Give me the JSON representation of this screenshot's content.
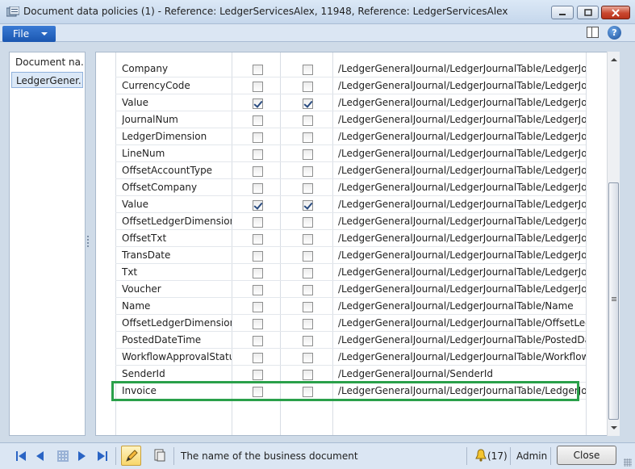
{
  "window": {
    "title": "Document data policies (1) - Reference: LedgerServicesAlex, 11948, Reference: LedgerServicesAlex"
  },
  "menu": {
    "file_label": "File"
  },
  "left_pane": {
    "items": [
      {
        "label": "Document na...",
        "selected": false
      },
      {
        "label": "LedgerGener...",
        "selected": true
      }
    ]
  },
  "grid": {
    "rows": [
      {
        "name": "Company",
        "c1": false,
        "c2": false,
        "path": "/LedgerGeneralJournal/LedgerJournalTable/LedgerJo..."
      },
      {
        "name": "CurrencyCode",
        "c1": false,
        "c2": false,
        "path": "/LedgerGeneralJournal/LedgerJournalTable/LedgerJo..."
      },
      {
        "name": "Value",
        "c1": true,
        "c2": true,
        "path": "/LedgerGeneralJournal/LedgerJournalTable/LedgerJo..."
      },
      {
        "name": "JournalNum",
        "c1": false,
        "c2": false,
        "path": "/LedgerGeneralJournal/LedgerJournalTable/LedgerJo..."
      },
      {
        "name": "LedgerDimension",
        "c1": false,
        "c2": false,
        "path": "/LedgerGeneralJournal/LedgerJournalTable/LedgerJo..."
      },
      {
        "name": "LineNum",
        "c1": false,
        "c2": false,
        "path": "/LedgerGeneralJournal/LedgerJournalTable/LedgerJo..."
      },
      {
        "name": "OffsetAccountType",
        "c1": false,
        "c2": false,
        "path": "/LedgerGeneralJournal/LedgerJournalTable/LedgerJo..."
      },
      {
        "name": "OffsetCompany",
        "c1": false,
        "c2": false,
        "path": "/LedgerGeneralJournal/LedgerJournalTable/LedgerJo..."
      },
      {
        "name": "Value",
        "c1": true,
        "c2": true,
        "path": "/LedgerGeneralJournal/LedgerJournalTable/LedgerJo..."
      },
      {
        "name": "OffsetLedgerDimension",
        "c1": false,
        "c2": false,
        "path": "/LedgerGeneralJournal/LedgerJournalTable/LedgerJo..."
      },
      {
        "name": "OffsetTxt",
        "c1": false,
        "c2": false,
        "path": "/LedgerGeneralJournal/LedgerJournalTable/LedgerJo..."
      },
      {
        "name": "TransDate",
        "c1": false,
        "c2": false,
        "path": "/LedgerGeneralJournal/LedgerJournalTable/LedgerJo..."
      },
      {
        "name": "Txt",
        "c1": false,
        "c2": false,
        "path": "/LedgerGeneralJournal/LedgerJournalTable/LedgerJo..."
      },
      {
        "name": "Voucher",
        "c1": false,
        "c2": false,
        "path": "/LedgerGeneralJournal/LedgerJournalTable/LedgerJo..."
      },
      {
        "name": "Name",
        "c1": false,
        "c2": false,
        "path": "/LedgerGeneralJournal/LedgerJournalTable/Name"
      },
      {
        "name": "OffsetLedgerDimension",
        "c1": false,
        "c2": false,
        "path": "/LedgerGeneralJournal/LedgerJournalTable/OffsetLed..."
      },
      {
        "name": "PostedDateTime",
        "c1": false,
        "c2": false,
        "path": "/LedgerGeneralJournal/LedgerJournalTable/PostedDa..."
      },
      {
        "name": "WorkflowApprovalStatus",
        "c1": false,
        "c2": false,
        "path": "/LedgerGeneralJournal/LedgerJournalTable/Workflow..."
      },
      {
        "name": "SenderId",
        "c1": false,
        "c2": false,
        "path": "/LedgerGeneralJournal/SenderId"
      },
      {
        "name": "Invoice",
        "c1": false,
        "c2": false,
        "path": "/LedgerGeneralJournal/LedgerJournalTable/LedgerJo..."
      }
    ]
  },
  "status": {
    "description": "The name of the business document",
    "alerts": "(17)",
    "user": "Admin",
    "close_label": "Close"
  },
  "colors": {
    "highlight": "#2aa04a",
    "accent": "#2a64c4"
  }
}
